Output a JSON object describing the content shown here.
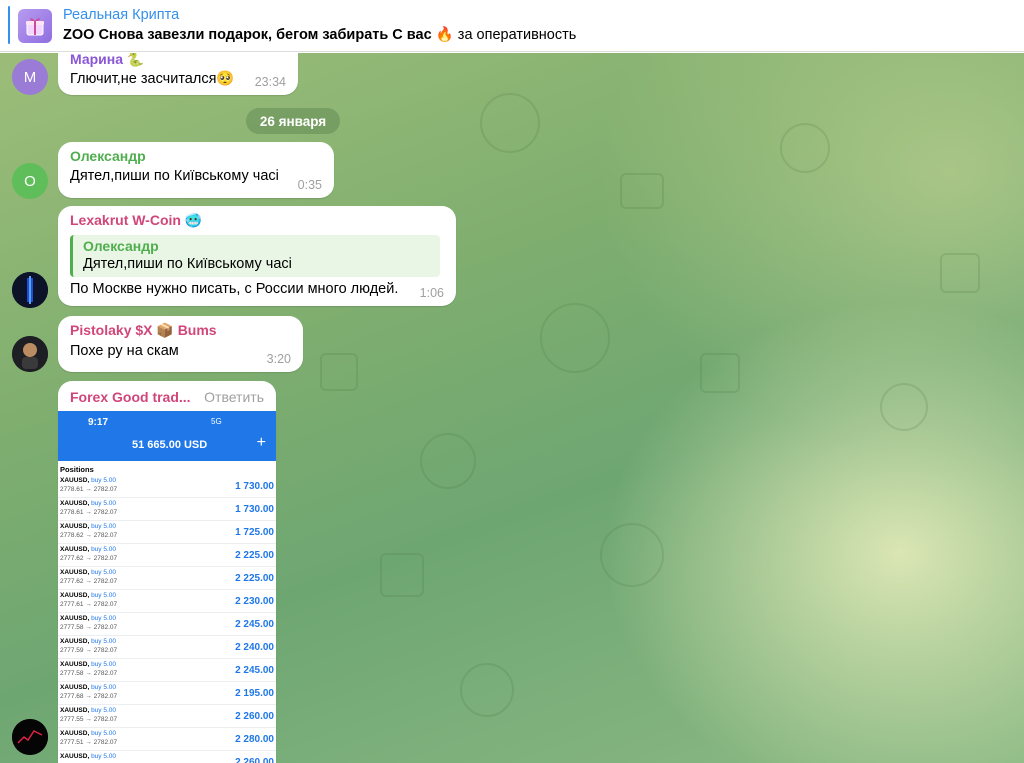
{
  "pinned": {
    "title": "Реальная Крипта",
    "text_bold": "ZOO Снова завезли подарок, бегом забирать  С вас",
    "emoji": "🔥",
    "text_rest": " за оперативность"
  },
  "messages": [
    {
      "sender": "Марина 🐍",
      "avatar_letter": "M",
      "text": "Глючит,не засчитался🥺",
      "time": "23:34",
      "sender_color": "#8a56d6"
    },
    {
      "sender": "Олександр",
      "avatar_letter": "О",
      "text": "Дятел,пиши по Київському часі",
      "time": "0:35",
      "sender_color": "#4fae4e"
    },
    {
      "sender": "Lexakrut W-Coin",
      "badge": "🥶",
      "reply_name": "Олександр",
      "reply_text": "Дятел,пиши по Київському часі",
      "text": "По Москве нужно писать, с России много людей.",
      "time": "1:06",
      "sender_color": "#d1467a"
    },
    {
      "sender": "Pistolaky $X 📦 Bums",
      "text": "Похе ру на скам",
      "time": "3:20",
      "sender_color": "#d1467a"
    }
  ],
  "date_separator": "26 января",
  "forward": {
    "sender": "Forex Good trad...",
    "reply_label": "Ответить",
    "phone": {
      "clock": "9:17",
      "signal": "5G",
      "balance": "51 665.00 USD",
      "plus": "+",
      "positions_title": "Positions",
      "rows": [
        {
          "sym": "XAUUSD,",
          "side": "buy 5.00",
          "prices": "2778.61 → 2782.07",
          "pl": "1 730.00"
        },
        {
          "sym": "XAUUSD,",
          "side": "buy 5.00",
          "prices": "2778.61 → 2782.07",
          "pl": "1 730.00"
        },
        {
          "sym": "XAUUSD,",
          "side": "buy 5.00",
          "prices": "2778.62 → 2782.07",
          "pl": "1 725.00"
        },
        {
          "sym": "XAUUSD,",
          "side": "buy 5.00",
          "prices": "2777.62 → 2782.07",
          "pl": "2 225.00"
        },
        {
          "sym": "XAUUSD,",
          "side": "buy 5.00",
          "prices": "2777.62 → 2782.07",
          "pl": "2 225.00"
        },
        {
          "sym": "XAUUSD,",
          "side": "buy 5.00",
          "prices": "2777.61 → 2782.07",
          "pl": "2 230.00"
        },
        {
          "sym": "XAUUSD,",
          "side": "buy 5.00",
          "prices": "2777.58 → 2782.07",
          "pl": "2 245.00"
        },
        {
          "sym": "XAUUSD,",
          "side": "buy 5.00",
          "prices": "2777.59 → 2782.07",
          "pl": "2 240.00"
        },
        {
          "sym": "XAUUSD,",
          "side": "buy 5.00",
          "prices": "2777.58 → 2782.07",
          "pl": "2 245.00"
        },
        {
          "sym": "XAUUSD,",
          "side": "buy 5.00",
          "prices": "2777.68 → 2782.07",
          "pl": "2 195.00"
        },
        {
          "sym": "XAUUSD,",
          "side": "buy 5.00",
          "prices": "2777.55 → 2782.07",
          "pl": "2 260.00"
        },
        {
          "sym": "XAUUSD,",
          "side": "buy 5.00",
          "prices": "2777.51 → 2782.07",
          "pl": "2 280.00"
        },
        {
          "sym": "XAUUSD,",
          "side": "buy 5.00",
          "prices": "",
          "pl": "2 260.00"
        }
      ]
    }
  }
}
